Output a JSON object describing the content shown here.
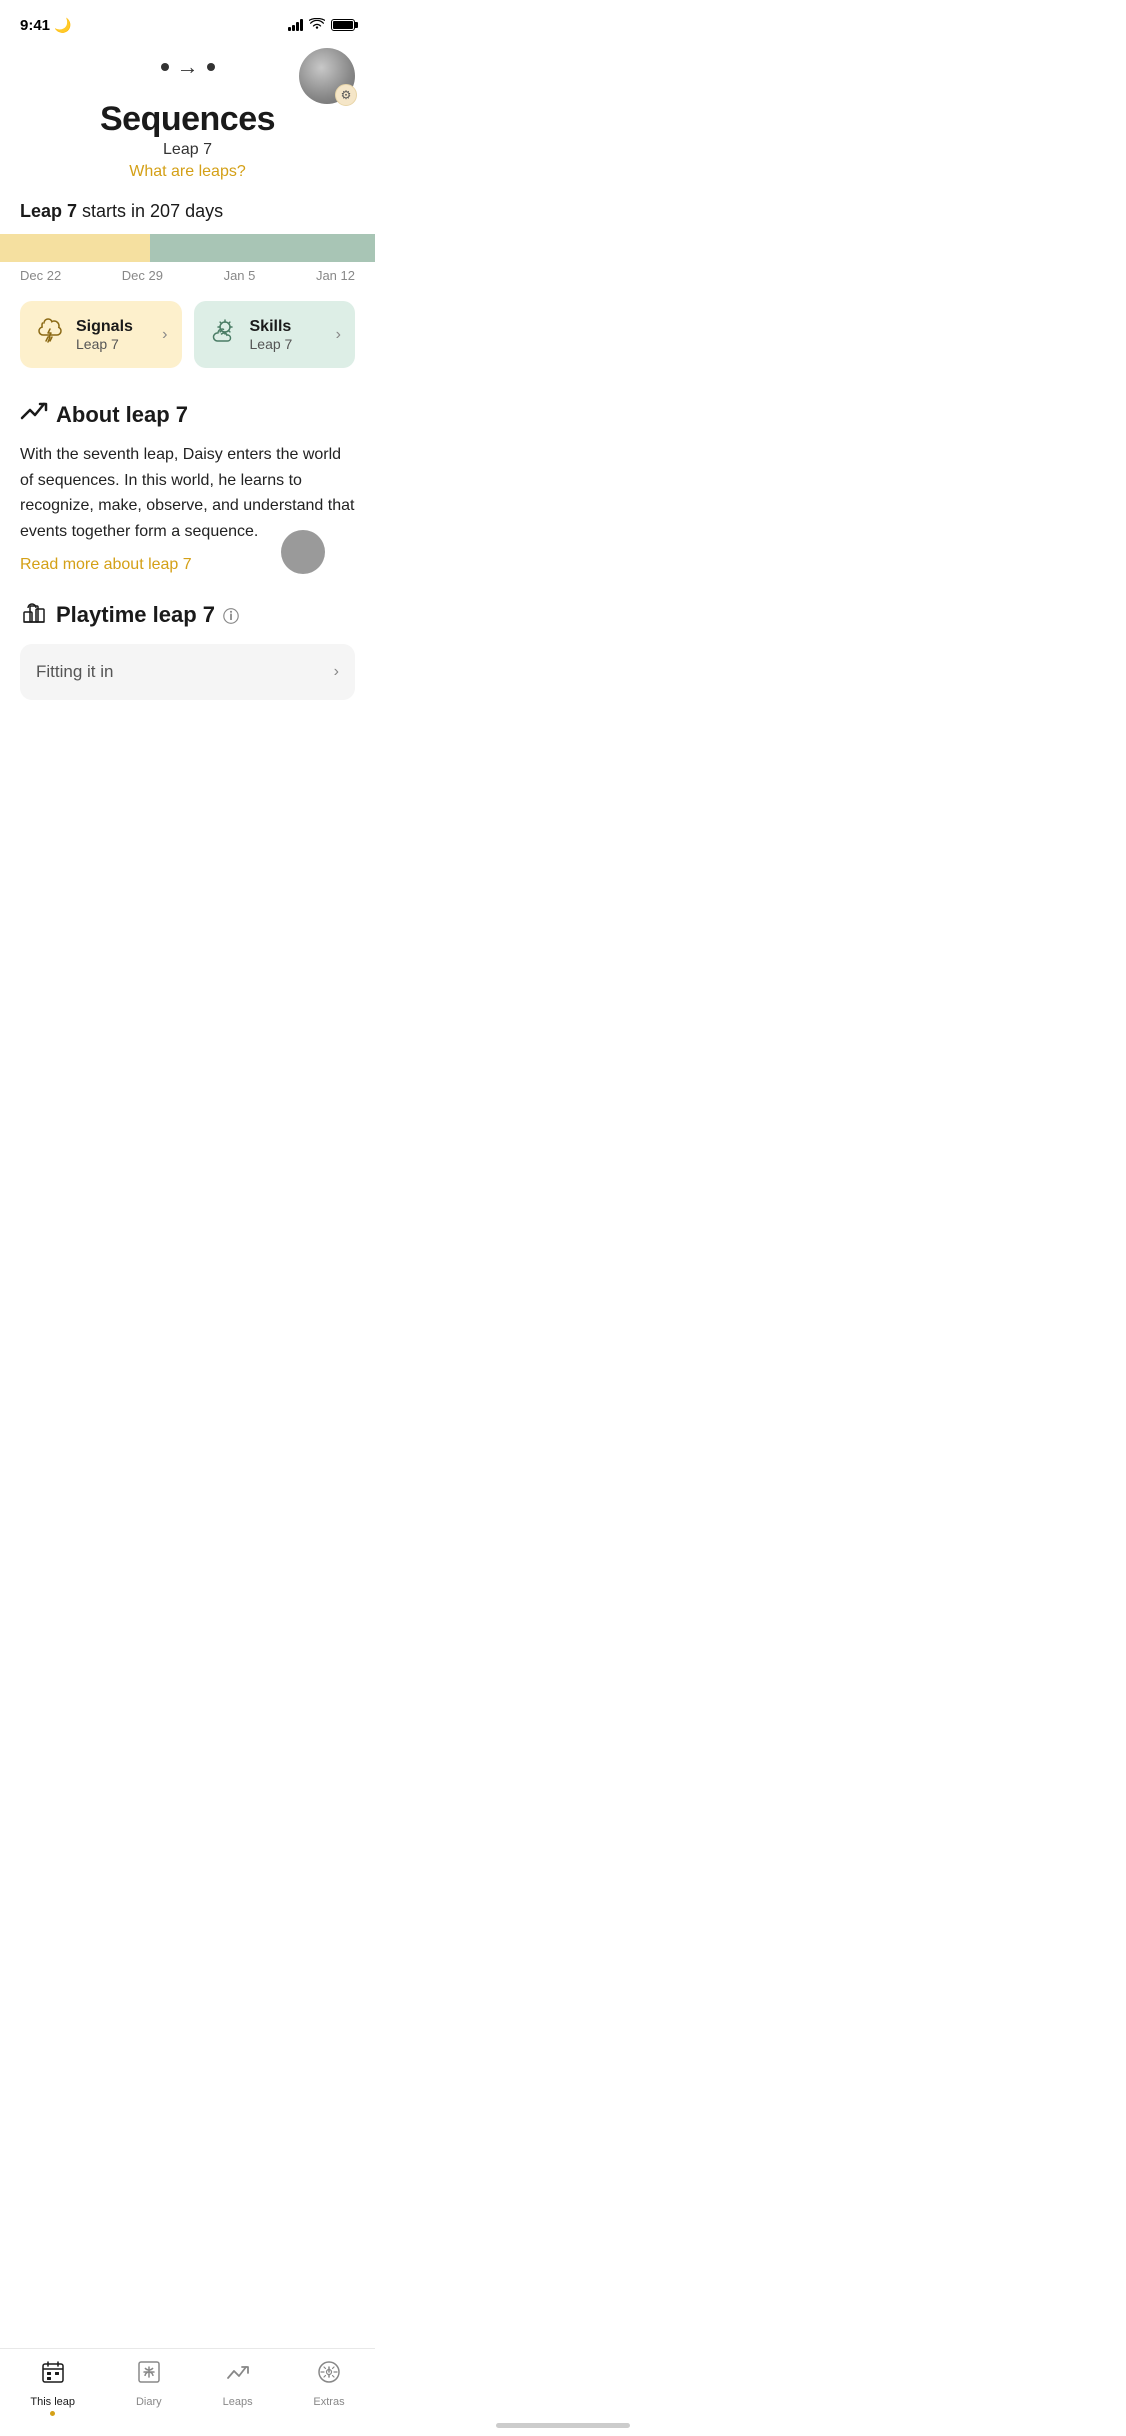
{
  "statusBar": {
    "time": "9:41",
    "moonIcon": "🌙"
  },
  "header": {
    "navDots": "• → •",
    "gearIcon": "⚙"
  },
  "titleSection": {
    "title": "Sequences",
    "subtitle": "Leap 7",
    "whatAreLeaps": "What are leaps?"
  },
  "leapInfo": {
    "boldText": "Leap 7",
    "suffix": " starts in 207 days"
  },
  "dateLabels": {
    "dates": [
      "Dec 22",
      "Dec 29",
      "Jan 5",
      "Jan 12"
    ]
  },
  "cards": [
    {
      "title": "Signals",
      "subtitle": "Leap 7",
      "type": "yellow"
    },
    {
      "title": "Skills",
      "subtitle": "Leap 7",
      "type": "green"
    }
  ],
  "aboutSection": {
    "title": "About leap 7",
    "text": "With the seventh leap, Daisy  enters the world of sequences. In this world, he learns to recognize, make, observe, and understand that events together form a sequence.",
    "readMore": "Read more about leap 7"
  },
  "playtimeSection": {
    "title": "Playtime leap 7",
    "fittingCard": "Fitting it in"
  },
  "tabBar": {
    "tabs": [
      {
        "label": "This leap",
        "active": true
      },
      {
        "label": "Diary",
        "active": false
      },
      {
        "label": "Leaps",
        "active": false
      },
      {
        "label": "Extras",
        "active": false
      }
    ]
  }
}
